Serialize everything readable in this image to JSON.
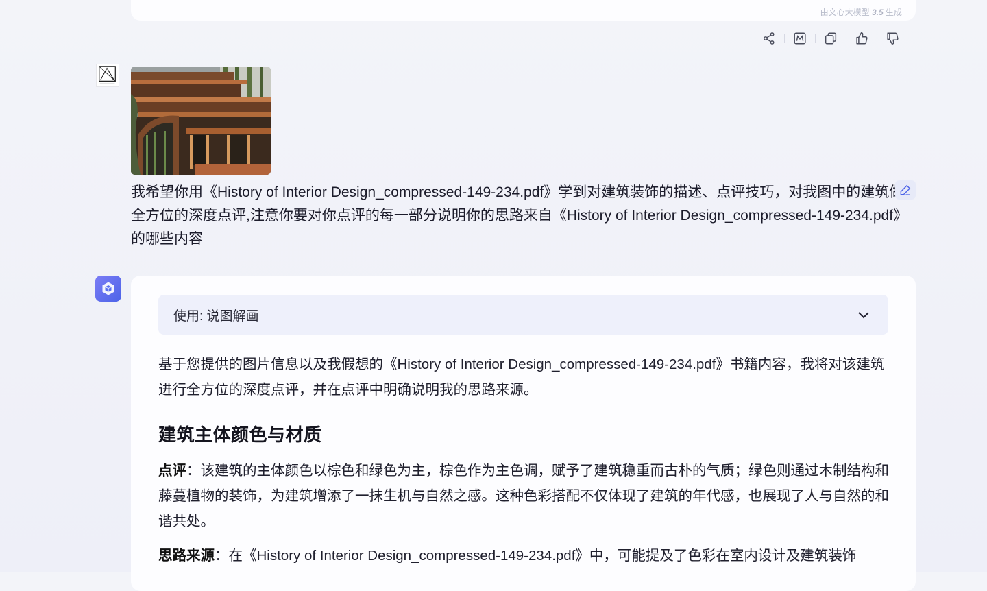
{
  "previous_message": {
    "generated_by_prefix": "由文心大模型",
    "model_version": "3.5",
    "generated_by_suffix": "生成"
  },
  "actions": [
    {
      "name": "share-icon"
    },
    {
      "name": "mindmap-icon"
    },
    {
      "name": "copy-icon"
    },
    {
      "name": "thumbs-up-icon"
    },
    {
      "name": "thumbs-down-icon"
    }
  ],
  "user_message": {
    "text": "我希望你用《History of Interior Design_compressed-149-234.pdf》学到对建筑装饰的描述、点评技巧，对我图中的建筑做全方位的深度点评,注意你要对你点评的每一部分说明你的思路来自《History of Interior Design_compressed-149-234.pdf》的哪些内容"
  },
  "assistant_message": {
    "plugin_label": "使用: 说图解画",
    "intro": "基于您提供的图片信息以及我假想的《History of Interior Design_compressed-149-234.pdf》书籍内容，我将对该建筑进行全方位的深度点评，并在点评中明确说明我的思路来源。",
    "section_title": "建筑主体颜色与材质",
    "review_label": "点评",
    "review_text": "：该建筑的主体颜色以棕色和绿色为主，棕色作为主色调，赋予了建筑稳重而古朴的气质；绿色则通过木制结构和藤蔓植物的装饰，为建筑增添了一抹生机与自然之感。这种色彩搭配不仅体现了建筑的年代感，也展现了人与自然的和谐共处。",
    "source_label": "思路来源",
    "source_text": "：在《History of Interior Design_compressed-149-234.pdf》中，可能提及了色彩在室内设计及建筑装饰"
  },
  "colors": {
    "accent": "#4c63e8",
    "page_bg": "#f1f2f8",
    "card_bg": "#fdfdff",
    "plugin_bg": "#eef0fb"
  }
}
